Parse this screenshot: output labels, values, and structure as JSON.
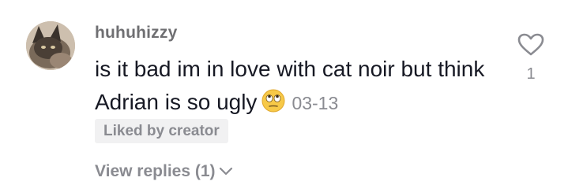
{
  "comment": {
    "username": "huhuhizzy",
    "text": "is it bad im in love with cat noir but think Adrian is so ugly",
    "emoji": "face-with-rolling-eyes-icon",
    "date": "03-13",
    "liked_by_creator_label": "Liked by creator",
    "view_replies_label": "View replies (1)",
    "like_count": "1"
  },
  "colors": {
    "username": "#6f6f72",
    "text": "#161823",
    "muted": "#8a8b91",
    "badge_bg": "#f1f1f2"
  }
}
